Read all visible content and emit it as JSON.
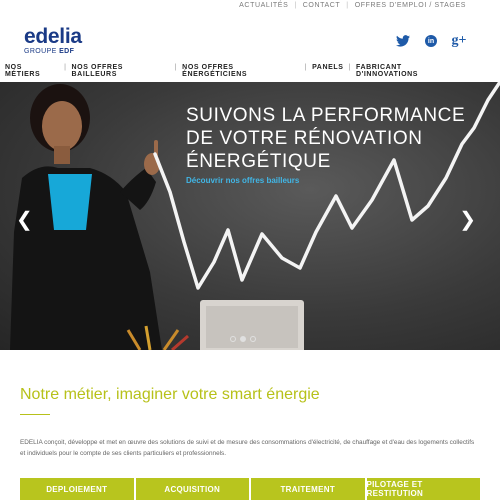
{
  "topbar": {
    "links": [
      "ACTUALITÉS",
      "CONTACT",
      "OFFRES D'EMPLOI / STAGES"
    ]
  },
  "header": {
    "logo_word": "edelia",
    "logo_sub_prefix": "GROUPE",
    "logo_sub_brand": "EDF",
    "social": {
      "twitter_icon": "twitter-icon",
      "linkedin_label": "in",
      "googleplus_label": "g+"
    },
    "nav": [
      "NOS MÉTIERS",
      "NOS OFFRES BAILLEURS",
      "NOS OFFRES ÉNERGÉTICIENS",
      "PANELS",
      "FABRICANT D'INNOVATIONS"
    ]
  },
  "hero": {
    "headline_1": "SUIVONS LA PERFORMANCE",
    "headline_2": "DE VOTRE RÉNOVATION",
    "headline_3": "ÉNERGÉTIQUE",
    "cta": "Découvrir nos offres bailleurs",
    "prev_glyph": "❮",
    "next_glyph": "❯",
    "slides_total": 3,
    "slide_active": 2
  },
  "content": {
    "title": "Notre métier, imaginer votre smart énergie",
    "description": "EDELIA conçoit, développe et met en œuvre des solutions de suivi et de mesure des consommations d'électricité, de chauffage et d'eau des logements collectifs et individuels pour le compte de ses clients particuliers et professionnels."
  },
  "tabs": [
    "DEPLOIEMENT",
    "ACQUISITION",
    "TRAITEMENT",
    "PILOTAGE ET RESTITUTION"
  ],
  "colors": {
    "brand_blue": "#1a3a86",
    "accent_green": "#b7c11a",
    "cta_blue": "#41b6e6"
  }
}
